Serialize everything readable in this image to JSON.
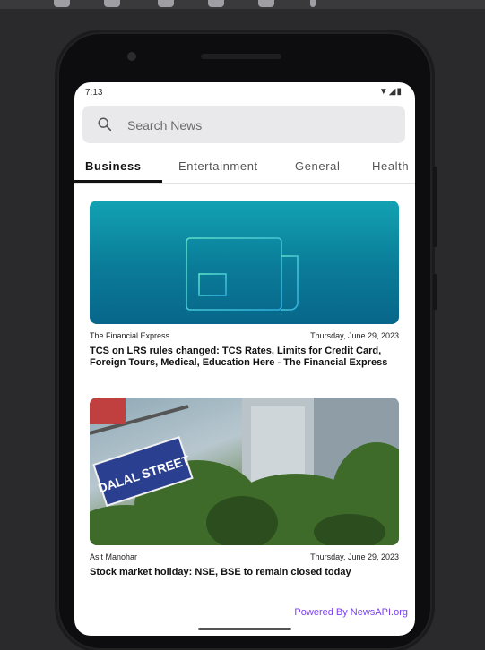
{
  "status_bar": {
    "time": "7:13",
    "icons": "▼◢▮"
  },
  "search": {
    "placeholder": "Search News"
  },
  "tabs": [
    {
      "label": "Business",
      "active": true
    },
    {
      "label": "Entertainment",
      "active": false
    },
    {
      "label": "General",
      "active": false
    },
    {
      "label": "Health",
      "active": false
    }
  ],
  "articles": [
    {
      "source": "The Financial Express",
      "date": "Thursday, June 29, 2023",
      "title": "TCS on LRS rules changed: TCS Rates, Limits for Credit Card, Foreign Tours, Medical, Education Here - The Financial Express",
      "image": "newspaper-placeholder"
    },
    {
      "source": "Asit Manohar",
      "date": "Thursday, June 29, 2023",
      "title": "Stock market holiday: NSE, BSE to remain closed today",
      "image": "dalal-street-photo",
      "image_sign": "DALAL STREET"
    }
  ],
  "footer": {
    "powered_prefix": "Powered By ",
    "powered_brand": "NewsAPI.org"
  },
  "colors": {
    "tab_indicator": "#111111",
    "placeholder_gradient_top": "#12a2b3",
    "placeholder_gradient_bottom": "#08668a",
    "powered_text": "#7b3ff2"
  }
}
